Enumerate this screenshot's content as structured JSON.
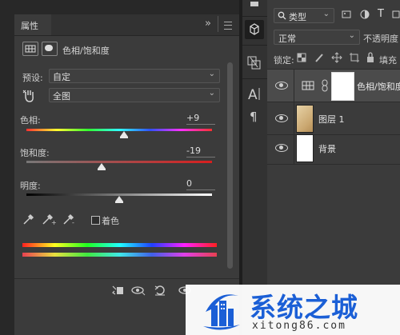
{
  "properties_panel": {
    "title": "属性",
    "collapse_glyph": "»",
    "adjustment_name": "色相/饱和度",
    "preset_label": "预设:",
    "preset_value": "自定",
    "channel_value": "全图",
    "hue_label": "色相:",
    "hue_value": "+9",
    "hue_level": 0.525,
    "saturation_label": "饱和度:",
    "saturation_value": "-19",
    "saturation_level": 0.405,
    "lightness_label": "明度:",
    "lightness_value": "0",
    "lightness_level": 0.5,
    "colorize_label": "着色",
    "colorize_checked": false
  },
  "layers_panel": {
    "filter_kind": "类型",
    "blend_mode": "正常",
    "opacity_label": "不透明度",
    "lock_label": "锁定:",
    "fill_label": "填充",
    "layers": [
      {
        "name": "色相/饱和度",
        "visible": true,
        "selected": true,
        "type": "adjustment"
      },
      {
        "name": "图层 1",
        "visible": true,
        "selected": false,
        "type": "image"
      },
      {
        "name": "背景",
        "visible": true,
        "selected": false,
        "type": "white"
      }
    ]
  },
  "watermark": {
    "title": "系统之城",
    "url": "xitong86.com"
  },
  "colors": {
    "panel_bg": "#3b3b3b",
    "dark_bg": "#282828",
    "selected_row": "#4b4b4b",
    "watermark_blue": "#1b5fd6"
  }
}
